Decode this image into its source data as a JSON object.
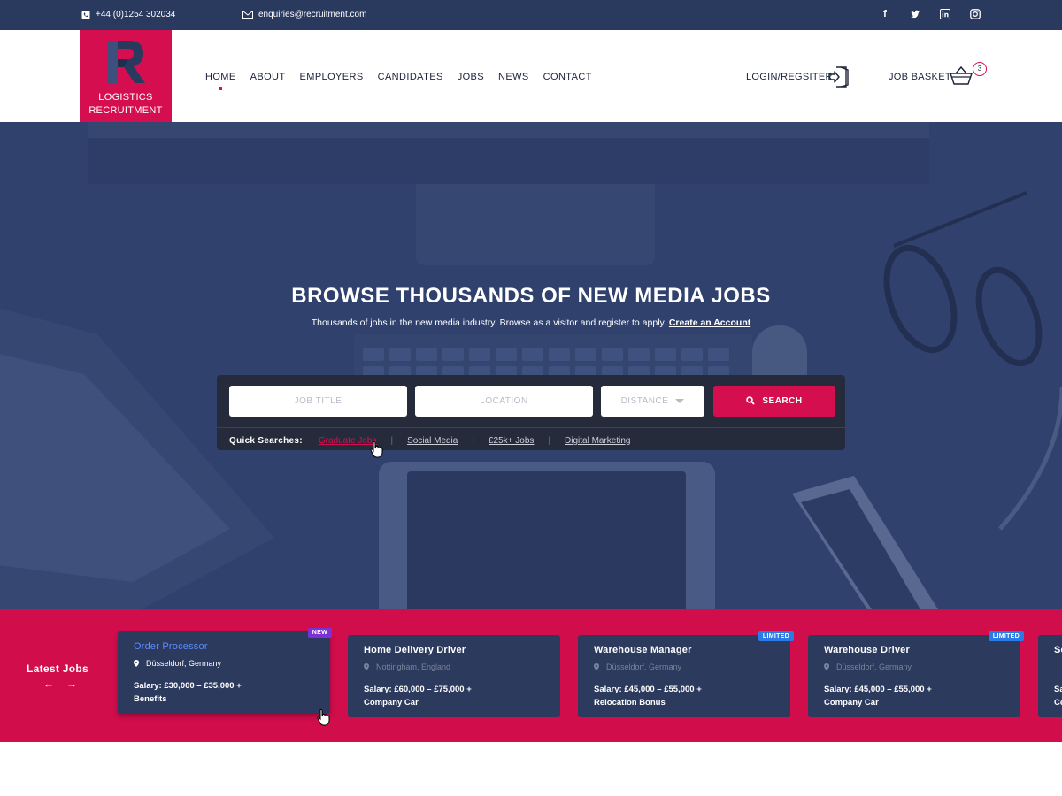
{
  "topbar": {
    "phone": "+44 (0)1254 302034",
    "email": "enquiries@recruitment.com",
    "socials": [
      "facebook-icon",
      "twitter-icon",
      "linkedin-icon",
      "instagram-icon"
    ]
  },
  "header": {
    "logo_letter": "R",
    "logo_line1": "LOGISTICS",
    "logo_line2": "RECRUITMENT",
    "nav": [
      "HOME",
      "ABOUT",
      "EMPLOYERS",
      "CANDIDATES",
      "JOBS",
      "NEWS",
      "CONTACT"
    ],
    "active_nav": "HOME",
    "login_label": "LOGIN/REGSITER",
    "basket_label": "JOB BASKET",
    "basket_count": "3"
  },
  "hero": {
    "title": "BROWSE THOUSANDS OF NEW MEDIA JOBS",
    "subtitle": "Thousands of jobs in the new media industry. Browse as a visitor and register to apply.",
    "subtitle_link": "Create an Account"
  },
  "search": {
    "job_title_placeholder": "JOB TITLE",
    "location_placeholder": "LOCATION",
    "distance_label": "DISTANCE",
    "button_label": "SEARCH",
    "quick_label": "Quick Searches:",
    "quick_links": [
      "Graduate Jobs",
      "Social Media",
      "£25k+ Jobs",
      "Digital Marketing"
    ],
    "active_quick": "Graduate Jobs"
  },
  "latest": {
    "title": "Latest Jobs",
    "prev_arrow": "←",
    "next_arrow": "→",
    "jobs": [
      {
        "title": "Order Processor",
        "location": "Düsseldorf, Germany",
        "salary_line1": "Salary: £30,000 – £35,000 +",
        "salary_line2": "Benefits",
        "badge": "NEW"
      },
      {
        "title": "Home Delivery Driver",
        "location": "Nottingham, England",
        "salary_line1": "Salary: £60,000 – £75,000 +",
        "salary_line2": "Company Car",
        "badge": ""
      },
      {
        "title": "Warehouse Manager",
        "location": "Düsseldorf, Germany",
        "salary_line1": "Salary: £45,000 – £55,000 +",
        "salary_line2": "Relocation Bonus",
        "badge": "LIMITED"
      },
      {
        "title": "Warehouse Driver",
        "location": "Düsseldorf, Germany",
        "salary_line1": "Salary: £45,000 – £55,000 +",
        "salary_line2": "Company Car",
        "badge": "LIMITED"
      },
      {
        "title": "Se",
        "location": "",
        "salary_line1": "Sa",
        "salary_line2": "Co",
        "badge": ""
      }
    ]
  },
  "colors": {
    "brand": "#d50f4f",
    "navy": "#2a3a5e",
    "hero": "#344670"
  }
}
